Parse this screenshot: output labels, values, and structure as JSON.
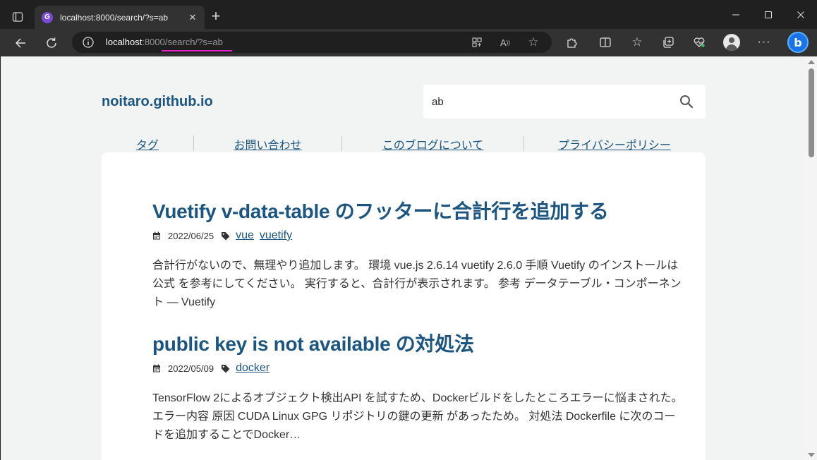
{
  "browser": {
    "tab_title": "localhost:8000/search/?s=ab",
    "tab_favicon": "G",
    "url_host": "localhost",
    "url_rest": ":8000/search/?s=ab",
    "icons": [
      "sidebar-icon",
      "close-icon",
      "plus-icon",
      "minimize-icon",
      "maximize-icon",
      "window-close-icon",
      "back-icon",
      "refresh-icon",
      "info-icon",
      "app-icon",
      "read-aloud-icon",
      "favorite-icon",
      "extensions-icon",
      "split-screen-icon",
      "favorites-icon",
      "collections-icon",
      "health-icon",
      "profile-icon",
      "more-icon",
      "copilot-icon"
    ],
    "colors": {
      "chrome_dark": "#202020",
      "chrome_toolbar": "#323232",
      "url_underline": "#e020c8",
      "copilot": "#1a73e8"
    }
  },
  "site": {
    "title": "noitaro.github.io",
    "search_value": "ab",
    "nav": [
      "タグ",
      "お問い合わせ",
      "このブログについて",
      "プライバシーポリシー"
    ]
  },
  "posts": [
    {
      "title": "Vuetify v-data-table のフッターに合計行を追加する",
      "date": "2022/06/25",
      "tags": [
        "vue",
        "vuetify"
      ],
      "excerpt": "合計行がないので、無理やり追加します。 環境 vue.js 2.6.14 vuetify 2.6.0 手順 Vuetify のインストールは 公式 を参考にしてください。 実行すると、合計行が表示されます。 参考 データテーブル・コンポーネント — Vuetify"
    },
    {
      "title": "public key is not available の対処法",
      "date": "2022/05/09",
      "tags": [
        "docker"
      ],
      "excerpt": "TensorFlow 2によるオブジェクト検出API を試すため、Dockerビルドをしたところエラーに悩まされた。 エラー内容 原因 CUDA Linux GPG リポジトリの鍵の更新 があったため。 対処法 Dockerfile に次のコードを追加することでDocker…"
    }
  ],
  "theme": {
    "link": "#1c5680",
    "page_bg": "#f2f4f4",
    "card_bg": "#ffffff"
  }
}
